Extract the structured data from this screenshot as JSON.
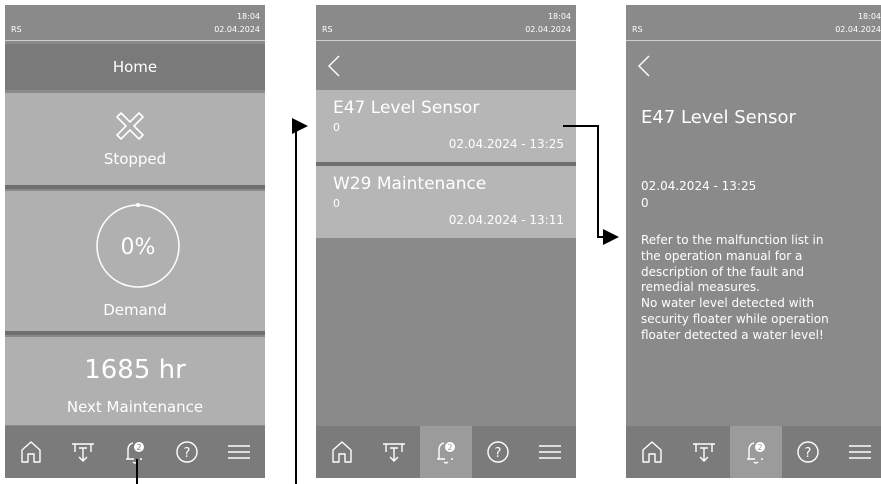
{
  "status_bar": {
    "rs": "RS",
    "time": "18:04",
    "date": "02.04.2024"
  },
  "home": {
    "title": "Home",
    "status_label": "Stopped",
    "demand_value": "0%",
    "demand_fraction": 0,
    "demand_label": "Demand",
    "maintenance_hours": "1685 hr",
    "maintenance_label": "Next Maintenance"
  },
  "nav": {
    "items": [
      "home-icon",
      "humidifier-icon",
      "bell-icon",
      "help-icon",
      "menu-icon"
    ],
    "alarm_badge": "2",
    "help_glyph": "?"
  },
  "alarms": [
    {
      "title": "E47 Level Sensor",
      "code": "0",
      "datetime": "02.04.2024 - 13:25"
    },
    {
      "title": "W29 Maintenance",
      "code": "0",
      "datetime": "02.04.2024 - 13:11"
    }
  ],
  "detail": {
    "title": "E47  Level Sensor",
    "datetime": "02.04.2024 - 13:25",
    "code": "0",
    "description_lines": [
      "Refer to the malfunction list in",
      "the operation manual for a",
      "description of the fault and",
      "remedial measures.",
      "No water level detected with",
      "security floater while operation",
      "floater detected a water level!"
    ]
  },
  "colors": {
    "screen_bg": "#8a8a8a",
    "tile_bg": "#b0b0b0",
    "nav_bg": "#7b7b7b",
    "nav_active": "#9b9b9b",
    "text": "#ffffff",
    "arrow": "#000000"
  }
}
